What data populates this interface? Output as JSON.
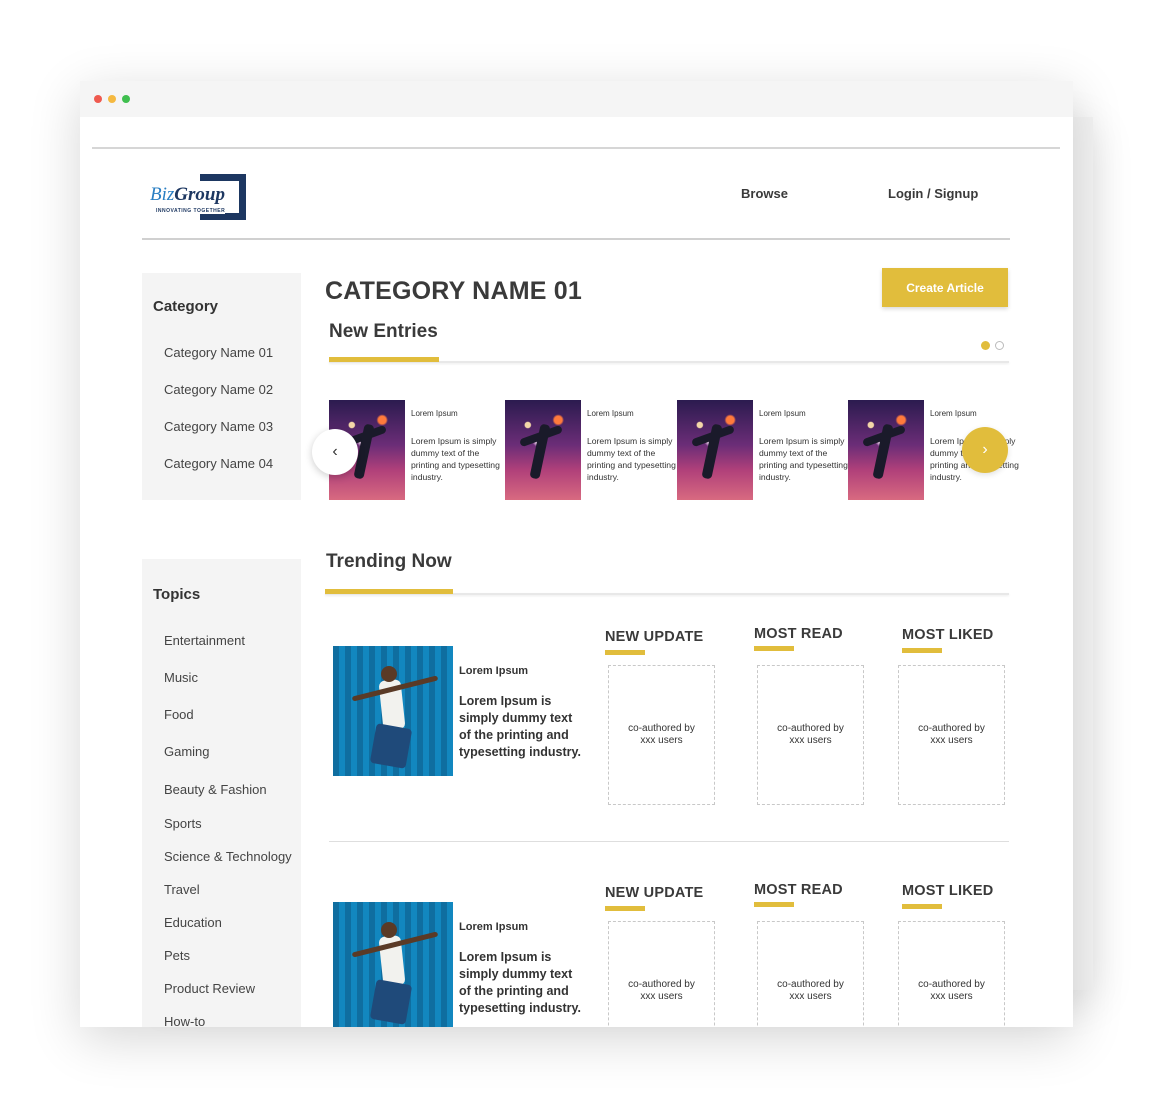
{
  "header": {
    "logo_biz": "Biz",
    "logo_group": "Group",
    "logo_tagline": "INNOVATING TOGETHER",
    "nav_browse": "Browse",
    "nav_login": "Login / Signup"
  },
  "sidebar": {
    "category_title": "Category",
    "categories": [
      "Category Name 01",
      "Category Name 02",
      "Category Name 03",
      "Category Name 04"
    ],
    "topics_title": "Topics",
    "topics": [
      "Entertainment",
      "Music",
      "Food",
      "Gaming",
      "Beauty & Fashion",
      "Sports",
      "Science & Technology",
      "Travel",
      "Education",
      "Pets",
      "Product Review",
      "How-to"
    ]
  },
  "main": {
    "heading": "CATEGORY NAME 01",
    "create_button": "Create Article",
    "new_entries_title": "New Entries",
    "carousel_page": 1,
    "carousel_pages": 2,
    "entries": [
      {
        "title": "Lorem Ipsum",
        "text": "Lorem Ipsum is simply dummy text of the printing and typesetting industry."
      },
      {
        "title": "Lorem Ipsum",
        "text": "Lorem Ipsum is simply dummy text of the printing and typesetting industry."
      },
      {
        "title": "Lorem Ipsum",
        "text": "Lorem Ipsum is simply dummy text of the printing and typesetting industry."
      },
      {
        "title": "Lorem Ipsum",
        "text": "Lorem Ipsum is simply dummy text of the printing and typesetting industry."
      }
    ],
    "prev_arrow": "‹",
    "next_arrow": "›",
    "trending_title": "Trending Now",
    "trending_rows": [
      {
        "title": "Lorem Ipsum",
        "text": "Lorem Ipsum is simply dummy text of the printing and typesetting industry.",
        "stats": [
          {
            "label": "NEW UPDATE",
            "box": "co-authored by xxx users"
          },
          {
            "label": "MOST READ",
            "box": "co-authored by xxx users"
          },
          {
            "label": "MOST LIKED",
            "box": "co-authored by xxx users"
          }
        ]
      },
      {
        "title": "Lorem Ipsum",
        "text": "Lorem Ipsum is simply dummy text of the printing and typesetting industry.",
        "stats": [
          {
            "label": "NEW UPDATE",
            "box": "co-authored by xxx users"
          },
          {
            "label": "MOST READ",
            "box": "co-authored by xxx users"
          },
          {
            "label": "MOST LIKED",
            "box": "co-authored by xxx users"
          }
        ]
      }
    ]
  },
  "colors": {
    "accent": "#e1bd3c",
    "brand_navy": "#1d3761",
    "brand_blue": "#2b7fc3"
  }
}
